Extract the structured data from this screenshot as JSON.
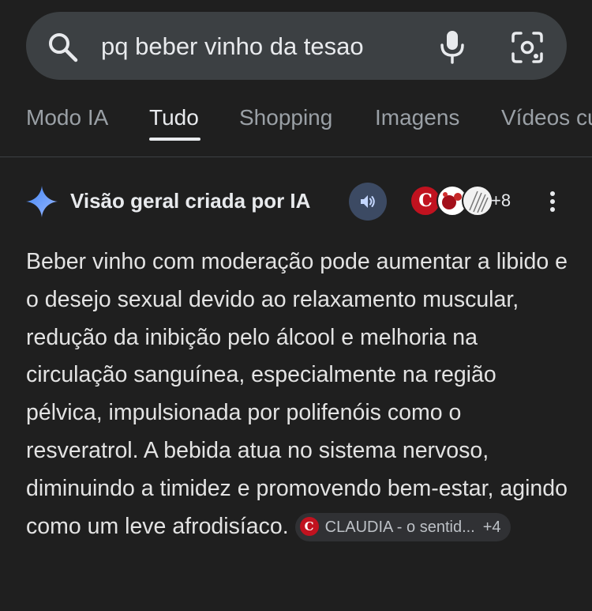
{
  "search": {
    "query": "pq beber vinho da tesao"
  },
  "tabs": [
    {
      "label": "Modo IA"
    },
    {
      "label": "Tudo"
    },
    {
      "label": "Shopping"
    },
    {
      "label": "Imagens"
    },
    {
      "label": "Vídeos cu"
    }
  ],
  "active_tab": "Tudo",
  "ai_overview": {
    "title": "Visão geral criada por IA",
    "source_logo_letter": "C",
    "sources_more": "+8",
    "answer": "Beber vinho com moderação pode aumentar a libido e o desejo sexual devido ao relaxamento muscular, redução da inibição pelo álcool e melhoria na circulação sanguínea, especialmente na região pélvica, impulsionada por polifenóis como o resveratrol. A bebida atua no sistema nervoso, diminuindo a timidez e promovendo bem-estar, agindo como um leve afrodisíaco.",
    "chip": {
      "logo_letter": "C",
      "label": "CLAUDIA - o sentid...",
      "count": "+4"
    }
  },
  "colors": {
    "background": "#1f1f1f",
    "search_bar": "#3c4043",
    "accent_sparkle": "#4285f4",
    "claudia_red": "#c1121f"
  },
  "icons": [
    "search-icon",
    "mic-icon",
    "lens-icon",
    "sparkle-icon",
    "speaker-icon",
    "more-vert-icon"
  ]
}
